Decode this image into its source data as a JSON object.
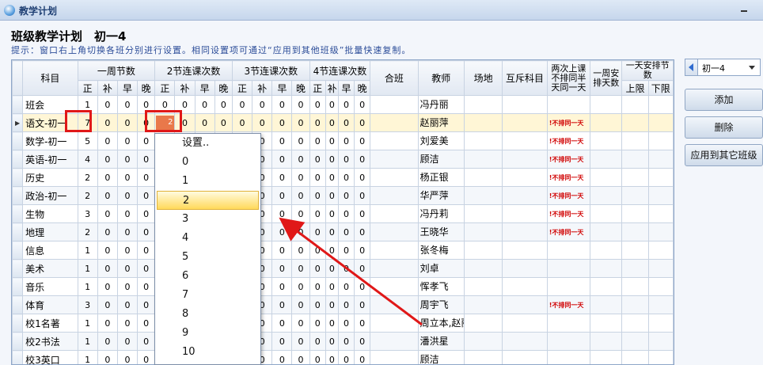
{
  "window": {
    "title": "教学计划"
  },
  "heading": "班级教学计划　初一4",
  "hint": "提示：窗口右上角切换各班分别进行设置。相同设置项可通过“应用到其他班级”批量快速复制。",
  "columns": {
    "subject": "科目",
    "weekly": "一周节数",
    "double": "2节连课次数",
    "triple": "3节连课次数",
    "quad": "4节连课次数",
    "sub": [
      "正",
      "补",
      "早",
      "晚"
    ],
    "merged_class": "合班",
    "teacher": "教师",
    "venue": "场地",
    "exclusive": "互斥科目",
    "two_sessions": "两次上课不排同半天同一天",
    "week_no_consecutive": "一周安排天数",
    "daily": "一天安排节数",
    "upper": "上限",
    "lower": "下限"
  },
  "rows": [
    {
      "subject": "班会",
      "weekly": [
        "1",
        "0",
        "0",
        "0"
      ],
      "double": [
        "0",
        "0",
        "0",
        "0"
      ],
      "triple": [
        "0",
        "0",
        "0",
        "0"
      ],
      "quad": [
        "0",
        "0",
        "0",
        "0"
      ],
      "teacher": "冯丹丽",
      "warn": ""
    },
    {
      "subject": "语文-初一",
      "weekly": [
        "7",
        "0",
        "0",
        "0"
      ],
      "double": [
        "2",
        "0",
        "0",
        "0"
      ],
      "triple": [
        "0",
        "0",
        "0",
        "0"
      ],
      "quad": [
        "0",
        "0",
        "0",
        "0"
      ],
      "teacher": "赵丽萍",
      "warn": "!不排同一天"
    },
    {
      "subject": "数学-初一",
      "weekly": [
        "5",
        "0",
        "0",
        "0"
      ],
      "double": [
        "",
        "",
        "",
        ""
      ],
      "triple": [
        "0",
        "0",
        "0",
        "0"
      ],
      "quad": [
        "0",
        "0",
        "0",
        "0"
      ],
      "teacher": "刘爱美",
      "warn": "!不排同一天"
    },
    {
      "subject": "英语-初一",
      "weekly": [
        "4",
        "0",
        "0",
        "0"
      ],
      "double": [
        "",
        "",
        "",
        ""
      ],
      "triple": [
        "0",
        "0",
        "0",
        "0"
      ],
      "quad": [
        "0",
        "0",
        "0",
        "0"
      ],
      "teacher": "顾洁",
      "warn": "!不排同一天"
    },
    {
      "subject": "历史",
      "weekly": [
        "2",
        "0",
        "0",
        "0"
      ],
      "double": [
        "",
        "",
        "",
        ""
      ],
      "triple": [
        "0",
        "0",
        "0",
        "0"
      ],
      "quad": [
        "0",
        "0",
        "0",
        "0"
      ],
      "teacher": "杨正银",
      "warn": "!不排同一天"
    },
    {
      "subject": "政治-初一",
      "weekly": [
        "2",
        "0",
        "0",
        "0"
      ],
      "double": [
        "",
        "",
        "",
        ""
      ],
      "triple": [
        "0",
        "0",
        "0",
        "0"
      ],
      "quad": [
        "0",
        "0",
        "0",
        "0"
      ],
      "teacher": "华严萍",
      "warn": "!不排同一天"
    },
    {
      "subject": "生物",
      "weekly": [
        "3",
        "0",
        "0",
        "0"
      ],
      "double": [
        "",
        "",
        "",
        ""
      ],
      "triple": [
        "0",
        "0",
        "0",
        "0"
      ],
      "quad": [
        "0",
        "0",
        "0",
        "0"
      ],
      "teacher": "冯丹莉",
      "warn": "!不排同一天"
    },
    {
      "subject": "地理",
      "weekly": [
        "2",
        "0",
        "0",
        "0"
      ],
      "double": [
        "",
        "",
        "",
        ""
      ],
      "triple": [
        "0",
        "0",
        "0",
        "0"
      ],
      "quad": [
        "0",
        "0",
        "0",
        "0"
      ],
      "teacher": "王晓华",
      "warn": "!不排同一天"
    },
    {
      "subject": "信息",
      "weekly": [
        "1",
        "0",
        "0",
        "0"
      ],
      "double": [
        "",
        "",
        "",
        ""
      ],
      "triple": [
        "0",
        "0",
        "0",
        "0"
      ],
      "quad": [
        "0",
        "0",
        "0",
        "0"
      ],
      "teacher": "张冬梅",
      "warn": ""
    },
    {
      "subject": "美术",
      "weekly": [
        "1",
        "0",
        "0",
        "0"
      ],
      "double": [
        "",
        "",
        "",
        ""
      ],
      "triple": [
        "0",
        "0",
        "0",
        "0"
      ],
      "quad": [
        "0",
        "0",
        "0",
        "0"
      ],
      "teacher": "刘卓",
      "warn": ""
    },
    {
      "subject": "音乐",
      "weekly": [
        "1",
        "0",
        "0",
        "0"
      ],
      "double": [
        "",
        "",
        "",
        ""
      ],
      "triple": [
        "0",
        "0",
        "0",
        "0"
      ],
      "quad": [
        "0",
        "0",
        "0",
        "0"
      ],
      "teacher": "恽孝飞",
      "warn": ""
    },
    {
      "subject": "体育",
      "weekly": [
        "3",
        "0",
        "0",
        "0"
      ],
      "double": [
        "",
        "",
        "",
        ""
      ],
      "triple": [
        "0",
        "0",
        "0",
        "0"
      ],
      "quad": [
        "0",
        "0",
        "0",
        "0"
      ],
      "teacher": "周宇飞",
      "warn": "!不排同一天"
    },
    {
      "subject": "校1名著",
      "weekly": [
        "1",
        "0",
        "0",
        "0"
      ],
      "double": [
        "",
        "",
        "",
        ""
      ],
      "triple": [
        "0",
        "0",
        "0",
        "0"
      ],
      "quad": [
        "0",
        "0",
        "0",
        "0"
      ],
      "teacher": "周立本,赵丽萍",
      "warn": ""
    },
    {
      "subject": "校2书法",
      "weekly": [
        "1",
        "0",
        "0",
        "0"
      ],
      "double": [
        "",
        "",
        "",
        ""
      ],
      "triple": [
        "0",
        "0",
        "0",
        "0"
      ],
      "quad": [
        "0",
        "0",
        "0",
        "0"
      ],
      "teacher": "潘洪星",
      "warn": ""
    },
    {
      "subject": "校3英口",
      "weekly": [
        "1",
        "0",
        "0",
        "0"
      ],
      "double": [
        "",
        "",
        "",
        ""
      ],
      "triple": [
        "0",
        "0",
        "0",
        "0"
      ],
      "quad": [
        "0",
        "0",
        "0",
        "0"
      ],
      "teacher": "顾洁",
      "warn": ""
    }
  ],
  "dropdown": {
    "options": [
      "设置..",
      "0",
      "1",
      "2",
      "3",
      "4",
      "5",
      "6",
      "7",
      "8",
      "9",
      "10"
    ],
    "selected": "2"
  },
  "side": {
    "class_value": "初一4",
    "add": "添加",
    "delete": "删除",
    "apply": "应用到其它班级"
  },
  "colors": {
    "highlight": "#e01818",
    "editing_cell": "#e9784a",
    "warn_text": "#d00000",
    "current_row": "#fff6d6"
  }
}
